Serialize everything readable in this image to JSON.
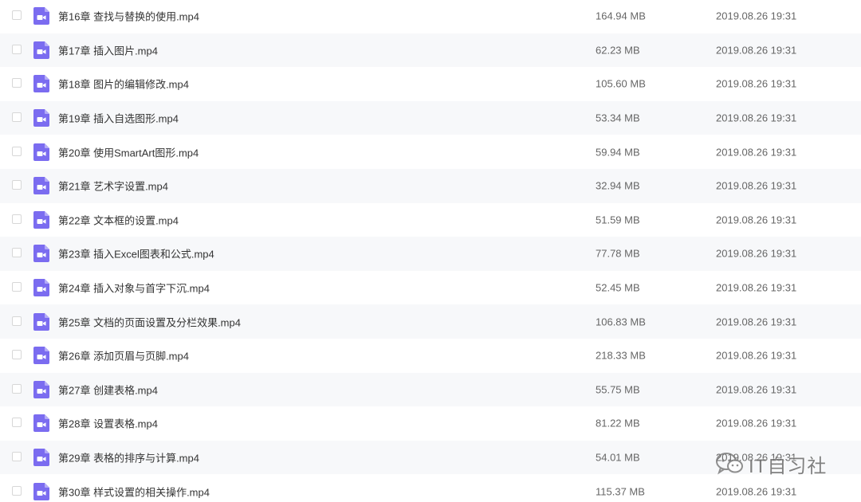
{
  "files": [
    {
      "name": "第16章 查找与替换的使用.mp4",
      "size": "164.94 MB",
      "date": "2019.08.26 19:31"
    },
    {
      "name": "第17章 插入图片.mp4",
      "size": "62.23 MB",
      "date": "2019.08.26 19:31"
    },
    {
      "name": "第18章 图片的编辑修改.mp4",
      "size": "105.60 MB",
      "date": "2019.08.26 19:31"
    },
    {
      "name": "第19章 插入自选图形.mp4",
      "size": "53.34 MB",
      "date": "2019.08.26 19:31"
    },
    {
      "name": "第20章 使用SmartArt图形.mp4",
      "size": "59.94 MB",
      "date": "2019.08.26 19:31"
    },
    {
      "name": "第21章 艺术字设置.mp4",
      "size": "32.94 MB",
      "date": "2019.08.26 19:31"
    },
    {
      "name": "第22章 文本框的设置.mp4",
      "size": "51.59 MB",
      "date": "2019.08.26 19:31"
    },
    {
      "name": "第23章 插入Excel图表和公式.mp4",
      "size": "77.78 MB",
      "date": "2019.08.26 19:31"
    },
    {
      "name": "第24章 插入对象与首字下沉.mp4",
      "size": "52.45 MB",
      "date": "2019.08.26 19:31"
    },
    {
      "name": "第25章 文档的页面设置及分栏效果.mp4",
      "size": "106.83 MB",
      "date": "2019.08.26 19:31"
    },
    {
      "name": "第26章 添加页眉与页脚.mp4",
      "size": "218.33 MB",
      "date": "2019.08.26 19:31"
    },
    {
      "name": "第27章 创建表格.mp4",
      "size": "55.75 MB",
      "date": "2019.08.26 19:31"
    },
    {
      "name": "第28章 设置表格.mp4",
      "size": "81.22 MB",
      "date": "2019.08.26 19:31"
    },
    {
      "name": "第29章 表格的排序与计算.mp4",
      "size": "54.01 MB",
      "date": "2019.08.26 19:31"
    },
    {
      "name": "第30章 样式设置的相关操作.mp4",
      "size": "115.37 MB",
      "date": "2019.08.26 19:31"
    }
  ],
  "file_icon": "video-file-icon",
  "watermark": {
    "text": "IT自习社",
    "icon": "wechat-icon"
  },
  "colors": {
    "icon": "#7b6cf0",
    "row_alt": "#f7f8fa",
    "text": "#333333",
    "meta": "#666666"
  }
}
